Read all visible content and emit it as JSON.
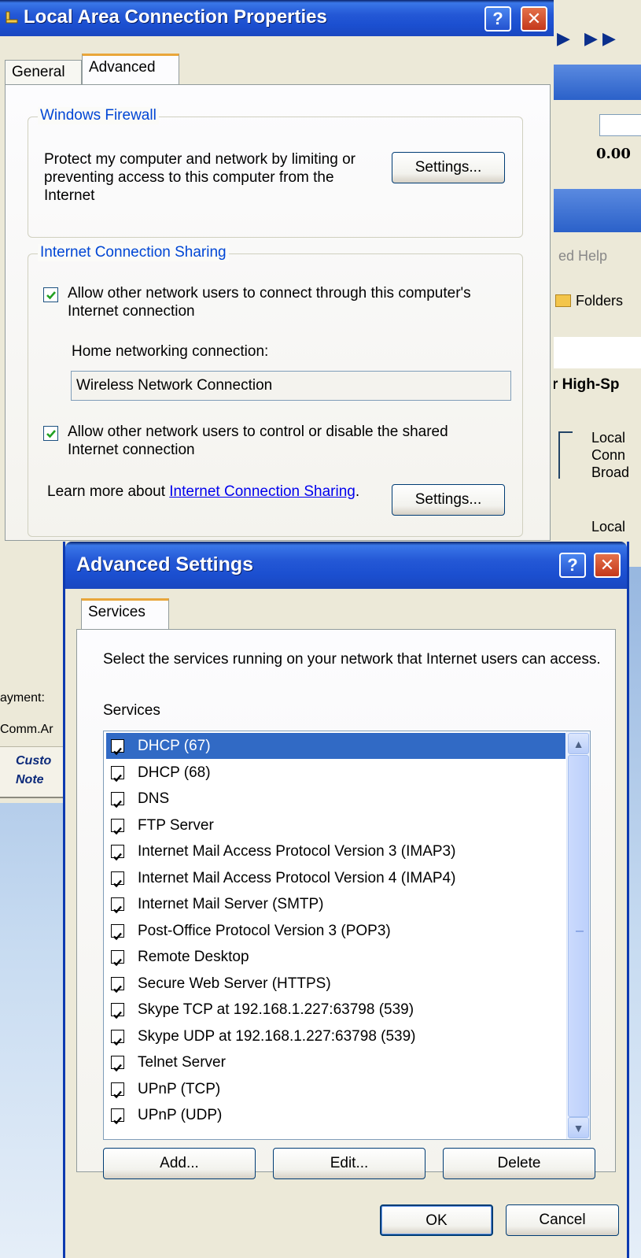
{
  "background_app": {
    "value": "0.00",
    "menu_fragment": "ed   Help",
    "folders_label": "Folders",
    "heading_fragment": "r High-Sp",
    "item1": [
      "Local",
      "Conn",
      "Broad"
    ],
    "item2": "Local"
  },
  "background_left": {
    "line1": "ayment:",
    "line2": "Comm.Ar",
    "line3": "Custo",
    "line4": "Note"
  },
  "properties_dialog": {
    "title": "Local Area Connection Properties",
    "help_button": "?",
    "close_button": "✕",
    "tabs": [
      {
        "label": "General"
      },
      {
        "label": "Advanced"
      }
    ],
    "firewall": {
      "legend": "Windows Firewall",
      "description": "Protect my computer and network by limiting or preventing access to this computer from the Internet",
      "settings_button": "Settings..."
    },
    "ics": {
      "legend": "Internet Connection Sharing",
      "allow_connect": "Allow other network users to connect through this computer's Internet connection",
      "allow_connect_checked": true,
      "home_label": "Home networking connection:",
      "home_value": "Wireless Network Connection",
      "allow_control": "Allow other network users to control or disable the shared Internet connection",
      "allow_control_checked": true,
      "learn_more_prefix": "Learn more about ",
      "learn_more_link": "Internet Connection Sharing",
      "learn_more_suffix": ".",
      "settings_button": "Settings..."
    }
  },
  "advanced_dialog": {
    "title": "Advanced Settings",
    "help_button": "?",
    "close_button": "✕",
    "tab": "Services",
    "instructions": "Select the services running on your network that Internet users can access.",
    "services_label": "Services",
    "services": [
      {
        "label": "DHCP (67)",
        "checked": true,
        "selected": true
      },
      {
        "label": "DHCP (68)",
        "checked": true
      },
      {
        "label": "DNS",
        "checked": true
      },
      {
        "label": "FTP Server",
        "checked": true
      },
      {
        "label": "Internet Mail Access Protocol Version 3 (IMAP3)",
        "checked": true
      },
      {
        "label": "Internet Mail Access Protocol Version 4 (IMAP4)",
        "checked": true
      },
      {
        "label": "Internet Mail Server (SMTP)",
        "checked": true
      },
      {
        "label": "Post-Office Protocol Version 3 (POP3)",
        "checked": true
      },
      {
        "label": "Remote Desktop",
        "checked": true
      },
      {
        "label": "Secure Web Server (HTTPS)",
        "checked": true
      },
      {
        "label": "Skype TCP at 192.168.1.227:63798 (539)",
        "checked": true
      },
      {
        "label": "Skype UDP at 192.168.1.227:63798 (539)",
        "checked": true
      },
      {
        "label": "Telnet Server",
        "checked": true
      },
      {
        "label": "UPnP (TCP)",
        "checked": true
      },
      {
        "label": "UPnP (UDP)",
        "checked": true
      }
    ],
    "buttons": {
      "add": "Add...",
      "edit": "Edit...",
      "delete": "Delete",
      "ok": "OK",
      "cancel": "Cancel"
    }
  },
  "colors": {
    "title_bar": "#2458d6",
    "selection": "#316ac5",
    "group_legend": "#0046d5",
    "tab_highlight": "#e9a63a"
  }
}
